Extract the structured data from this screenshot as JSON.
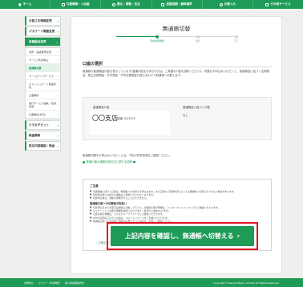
{
  "topnav": {
    "items": [
      {
        "label": "ホーム",
        "icon": "home-icon"
      },
      {
        "label": "口座情報・入出金",
        "icon": "account-icon"
      },
      {
        "label": "振込・振替・支払",
        "icon": "transfer-icon"
      },
      {
        "label": "定額自動・資料請求",
        "icon": "document-icon"
      },
      {
        "label": "お借入れ",
        "icon": "loan-icon"
      },
      {
        "label": "その他サービス",
        "icon": "services-icon"
      }
    ]
  },
  "sidebar": {
    "items": [
      {
        "label": "お客さま情報変更"
      },
      {
        "label": "パスワード関連変更"
      },
      {
        "label": "各種届出変更"
      }
    ],
    "sub_items": [
      {
        "label": "住所・電話番号変更"
      },
      {
        "label": "サービス利用停止"
      },
      {
        "label": "無通帳切替"
      },
      {
        "label": "カードローンサービス"
      },
      {
        "label": "キャッシュカード関連手続"
      },
      {
        "label": "口座解約"
      },
      {
        "label": "他行サービス連携・住所変更"
      },
      {
        "label": "口座解約(外貨)"
      }
    ],
    "bottom_items": [
      {
        "label": "りそなデビット"
      },
      {
        "label": "税金関係"
      },
      {
        "label": "取引内容確認・照会"
      }
    ]
  },
  "main": {
    "title": "無通帳切替",
    "steps": [
      "手続内容選択",
      "確認",
      "完了"
    ],
    "section_title": "口座の選択",
    "intro": "無通帳の普通預金口座を表示しています(普通口座をお持ちの方は、ご希望の口座を選択ください)。切替をお申込みいただくと、普通預金に紐づく定期預金・積立定期預金・外貨預金・外貨定期預金口座もあわせて無通帳へ切替えます。",
    "account": {
      "label_left": "普通預金口座",
      "label_right": "普通預金に紐づく口座",
      "name": "〇〇支店",
      "number": "普通 2222222",
      "linked": "なし"
    },
    "note": "無通帳切替をお申込みいただくには、下記の同意事項をご確認ください。",
    "link": "普通口座の通帳利用方法に関する説明",
    "caution": {
      "title": "ご注意",
      "items": [
        "普通預金に紐づく口座は、無通帳への切替えを申込みます。また口座のご利用状況によっては無通帳へ切替えができない場合があります。",
        "切替申込時にお持ちの通帳はご利用いただけなくなります。",
        "切替申込後は、通帳を再発行することはできません。"
      ],
      "subtitle": "無通帳口座への切替後の取扱い",
      "sub_items": [
        "切替申込日までの取引は通帳に記帳して下さい。切替後の取引明細は、インターネットバンキングでご確認いただけます。",
        "マイゲートにてお取引明細を確認いただけます（当月から過去26ヶ月分）。",
        "口座の取引明細は、りそなグループアプリでもご確認いただけます。",
        "ATMや店頭窓口での入出金は、キャッシュカードをご利用いただけます。",
        "無通帳口座への切替後に通帳が必要になった場合は、店頭へご相談ください。"
      ]
    },
    "back_label": "お取引メニューへ",
    "submit_label": "上記内容を確認し、無通帳へ切替える"
  },
  "footer": {
    "links": [
      "お問合せ",
      "マイゲート利用規定",
      "個人情報保護方針"
    ],
    "copyright": "Copyright © Resona Bank, Limited All Rights Reserved"
  },
  "colors": {
    "brand": "#1f9b58",
    "highlight": "#e0141f"
  }
}
